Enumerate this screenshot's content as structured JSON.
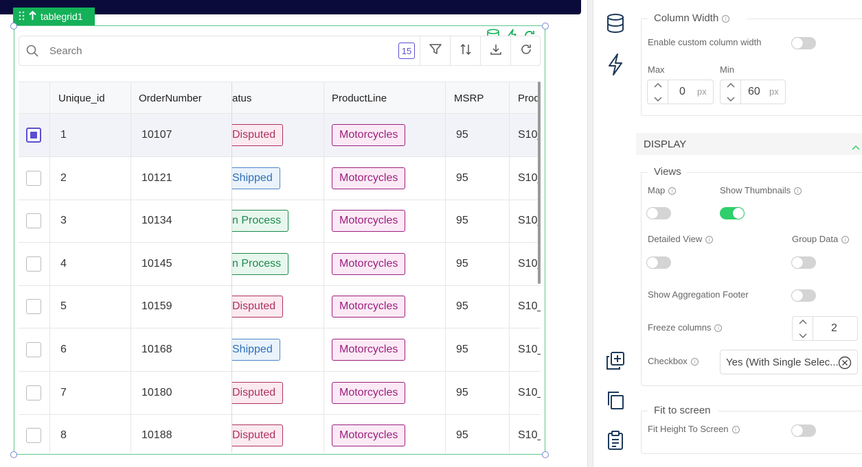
{
  "widget": {
    "name": "tablegrid1"
  },
  "toolbar": {
    "search_placeholder": "Search",
    "count": "15"
  },
  "columns": [
    "Unique_id",
    "OrderNumber",
    "atus",
    "ProductLine",
    "MSRP",
    "Prod"
  ],
  "rows": [
    {
      "id": "1",
      "order": "10107",
      "status": "Disputed",
      "product": "Motorcycles",
      "msrp": "95",
      "code": "S10_",
      "selected": true
    },
    {
      "id": "2",
      "order": "10121",
      "status": "Shipped",
      "product": "Motorcycles",
      "msrp": "95",
      "code": "S10_",
      "selected": false
    },
    {
      "id": "3",
      "order": "10134",
      "status": "n Process",
      "product": "Motorcycles",
      "msrp": "95",
      "code": "S10_",
      "selected": false
    },
    {
      "id": "4",
      "order": "10145",
      "status": "n Process",
      "product": "Motorcycles",
      "msrp": "95",
      "code": "S10_",
      "selected": false
    },
    {
      "id": "5",
      "order": "10159",
      "status": "Disputed",
      "product": "Motorcycles",
      "msrp": "95",
      "code": "S10_",
      "selected": false
    },
    {
      "id": "6",
      "order": "10168",
      "status": "Shipped",
      "product": "Motorcycles",
      "msrp": "95",
      "code": "S10_",
      "selected": false
    },
    {
      "id": "7",
      "order": "10180",
      "status": "Disputed",
      "product": "Motorcycles",
      "msrp": "95",
      "code": "S10_",
      "selected": false
    },
    {
      "id": "8",
      "order": "10188",
      "status": "Disputed",
      "product": "Motorcycles",
      "msrp": "95",
      "code": "S10_",
      "selected": false
    }
  ],
  "colors": {
    "accent": "#5b4fd1",
    "widget_green": "#14b158",
    "toggle_on": "#2fcf6c",
    "disputed": {
      "fg": "#b03060",
      "bg": "#fbeaf0",
      "border": "#b03060"
    },
    "shipped": {
      "fg": "#2f6fb5",
      "bg": "#eaf3fc",
      "border": "#4a86c8"
    },
    "in_process": {
      "fg": "#1d8a4c",
      "bg": "#e8f7ee",
      "border": "#1d8a4c"
    },
    "product": {
      "fg": "#9c1f7e",
      "bg": "#fbeaf6",
      "border": "#9c1f7e"
    }
  },
  "panel": {
    "column_width": {
      "title": "Column Width",
      "enable_label": "Enable custom column width",
      "max_label": "Max",
      "max_value": "0",
      "max_unit": "px",
      "min_label": "Min",
      "min_value": "60",
      "min_unit": "px"
    },
    "display": {
      "header": "DISPLAY"
    },
    "views": {
      "title": "Views",
      "map_label": "Map",
      "thumbnails_label": "Show Thumbnails",
      "detailed_label": "Detailed View",
      "group_label": "Group Data",
      "aggregation_label": "Show Aggregation Footer",
      "freeze_label": "Freeze columns",
      "freeze_value": "2",
      "checkbox_label": "Checkbox",
      "checkbox_value": "Yes (With Single Selec..."
    },
    "fit": {
      "title": "Fit to screen",
      "height_label": "Fit Height To Screen"
    }
  }
}
